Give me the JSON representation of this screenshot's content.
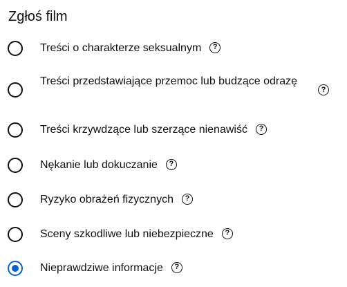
{
  "dialog": {
    "title": "Zgłoś film"
  },
  "options": [
    {
      "label": "Treści o charakterze seksualnym",
      "help_icon": "question-circle-icon",
      "selected": false
    },
    {
      "label": "Treści przedstawiające przemoc lub budzące odrazę",
      "help_icon": "question-circle-icon",
      "selected": false
    },
    {
      "label": "Treści krzywdzące lub szerzące nienawiść",
      "help_icon": "question-circle-icon",
      "selected": false
    },
    {
      "label": "Nękanie lub dokuczanie",
      "help_icon": "question-circle-icon",
      "selected": false
    },
    {
      "label": "Ryzyko obrażeń fizycznych",
      "help_icon": "question-circle-icon",
      "selected": false
    },
    {
      "label": "Sceny szkodliwe lub niebezpieczne",
      "help_icon": "question-circle-icon",
      "selected": false
    },
    {
      "label": "Nieprawdziwe informacje",
      "help_icon": "question-circle-icon",
      "selected": true
    }
  ],
  "colors": {
    "accent": "#065fd4",
    "text": "#0f0f0f",
    "background": "#ffffff"
  }
}
